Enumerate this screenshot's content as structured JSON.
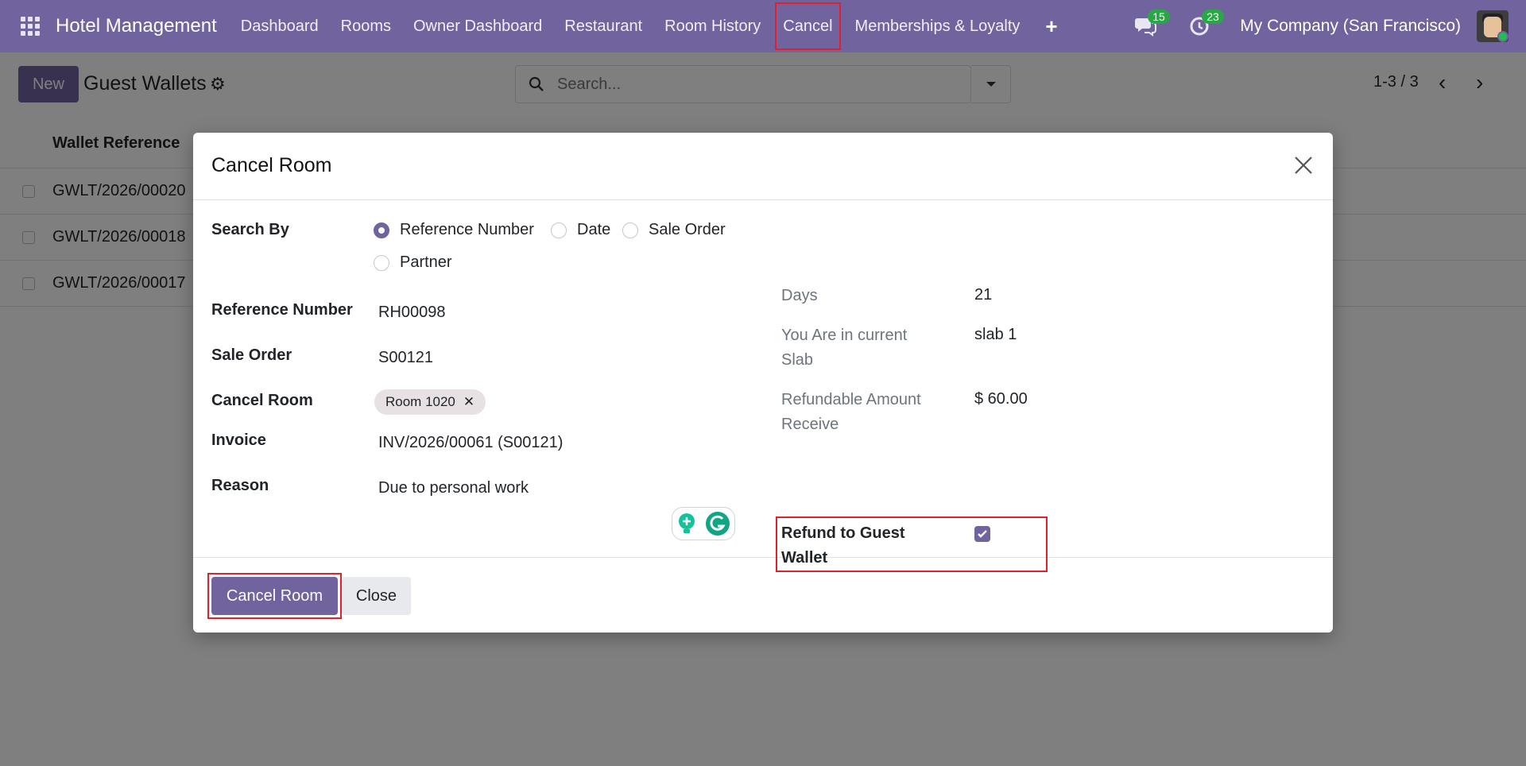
{
  "navbar": {
    "brand": "Hotel Management",
    "items": [
      {
        "label": "Dashboard"
      },
      {
        "label": "Rooms"
      },
      {
        "label": "Owner Dashboard"
      },
      {
        "label": "Restaurant"
      },
      {
        "label": "Room History"
      },
      {
        "label": "Cancel"
      },
      {
        "label": "Memberships & Loyalty"
      }
    ],
    "plus": "+",
    "messages_count": "15",
    "activities_count": "23",
    "company": "My Company (San Francisco)"
  },
  "control_panel": {
    "new_label": "New",
    "title": "Guest Wallets",
    "search_placeholder": "Search...",
    "pager": "1-3 / 3"
  },
  "list": {
    "column": "Wallet Reference",
    "rows": [
      "GWLT/2026/00020",
      "GWLT/2026/00018",
      "GWLT/2026/00017"
    ]
  },
  "modal": {
    "title": "Cancel Room",
    "search_by_label": "Search By",
    "search_options": [
      "Reference Number",
      "Date",
      "Sale Order",
      "Partner"
    ],
    "selected_option": "Reference Number",
    "reference_label": "Reference Number",
    "reference_value": "RH00098",
    "sale_order_label": "Sale Order",
    "sale_order_value": "S00121",
    "cancel_room_label": "Cancel Room",
    "cancel_room_tag": "Room 1020",
    "invoice_label": "Invoice",
    "invoice_value": "INV/2026/00061 (S00121)",
    "reason_label": "Reason",
    "reason_value": "Due to personal work",
    "days_label": "Days",
    "days_value": "21",
    "slab_label_line1": "You Are in current",
    "slab_label_line2": "Slab",
    "slab_value": "slab 1",
    "refundable_label_line1": "Refundable Amount",
    "refundable_label_line2": "Receive",
    "refundable_value": "$ 60.00",
    "refund_wallet_label_line1": "Refund to Guest",
    "refund_wallet_label_line2": "Wallet",
    "refund_wallet_checked": true,
    "primary_button": "Cancel Room",
    "secondary_button": "Close"
  },
  "colors": {
    "brand": "#71639e",
    "highlight": "#e0202a",
    "badge": "#28a745"
  }
}
